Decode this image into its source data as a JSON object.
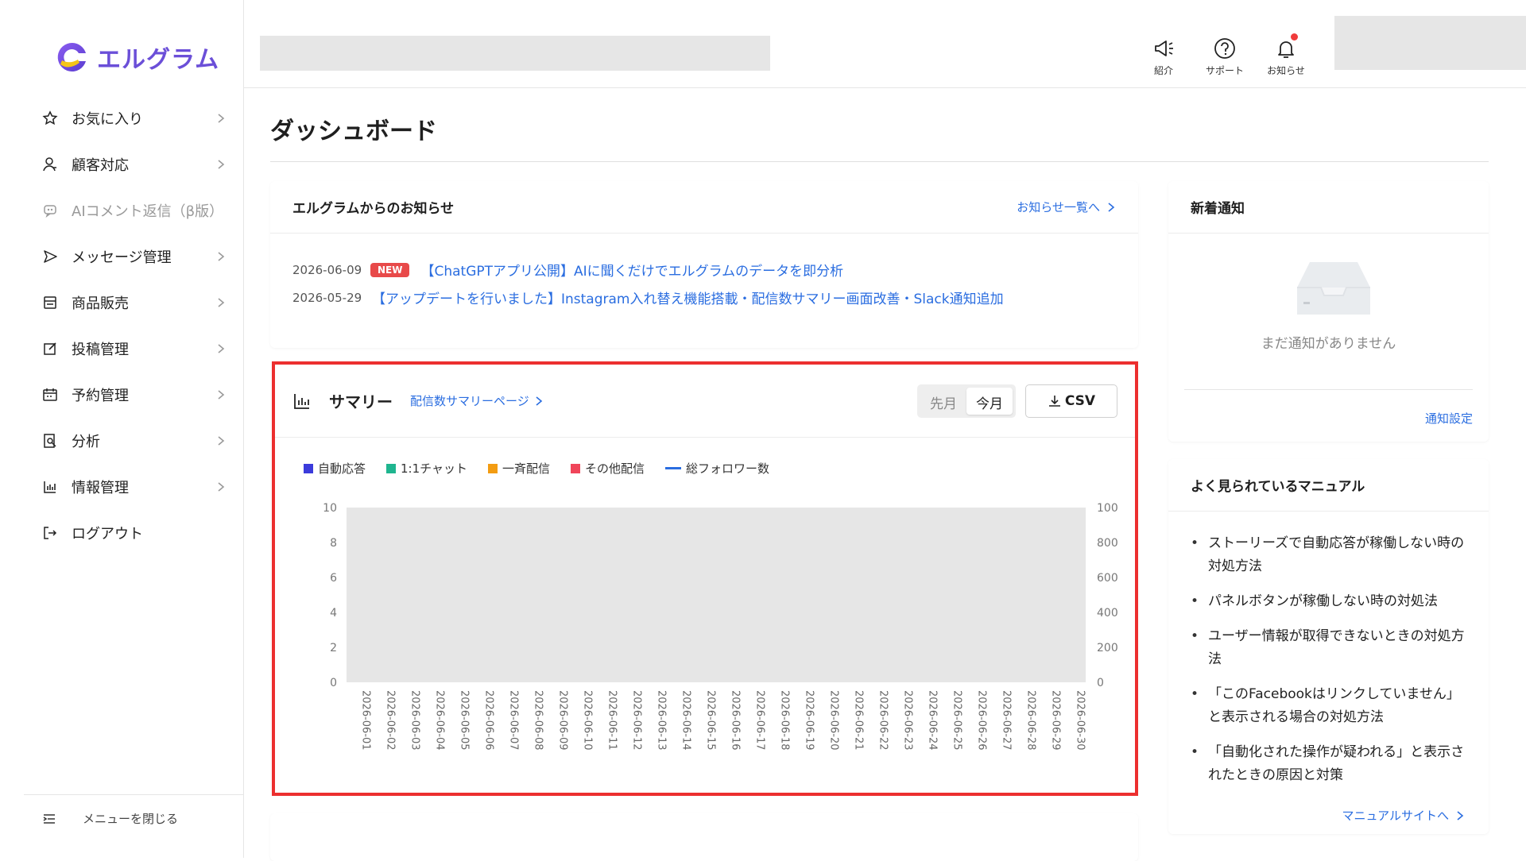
{
  "app": {
    "logo_text": "エルグラム",
    "brand_color": "#6b4fd8"
  },
  "sidebar": {
    "items": [
      {
        "label": "お気に入り",
        "icon": "star-icon",
        "has_chevron": true
      },
      {
        "label": "顧客対応",
        "icon": "user-icon",
        "has_chevron": true
      },
      {
        "label": "AIコメント返信（β版）",
        "icon": "ai-icon",
        "has_chevron": false,
        "disabled": true
      },
      {
        "label": "メッセージ管理",
        "icon": "send-icon",
        "has_chevron": true
      },
      {
        "label": "商品販売",
        "icon": "store-icon",
        "has_chevron": true
      },
      {
        "label": "投稿管理",
        "icon": "edit-icon",
        "has_chevron": true
      },
      {
        "label": "予約管理",
        "icon": "calendar-icon",
        "has_chevron": true
      },
      {
        "label": "分析",
        "icon": "analysis-icon",
        "has_chevron": true
      },
      {
        "label": "情報管理",
        "icon": "bar-chart-icon",
        "has_chevron": true
      },
      {
        "label": "ログアウト",
        "icon": "logout-icon",
        "has_chevron": false
      }
    ],
    "collapse_label": "メニューを閉じる"
  },
  "topbar": {
    "intro_label": "紹介",
    "support_label": "サポート",
    "notice_label": "お知らせ"
  },
  "page": {
    "title": "ダッシュボード"
  },
  "notice": {
    "title": "エルグラムからのお知らせ",
    "more_label": "お知らせ一覧へ",
    "items": [
      {
        "date": "2026-06-09",
        "badge": "NEW",
        "text": "【ChatGPTアプリ公開】AIに聞くだけでエルグラムのデータを即分析"
      },
      {
        "date": "2026-05-29",
        "badge": "",
        "text": "【アップデートを行いました】Instagram入れ替え機能搭載・配信数サマリー画面改善・Slack通知追加"
      }
    ]
  },
  "summary": {
    "title": "サマリー",
    "link_label": "配信数サマリーページ",
    "prev_month": "先月",
    "this_month": "今月",
    "csv_label": "CSV",
    "legend": [
      {
        "name": "自動応答",
        "color": "#3b3bdb",
        "kind": "square"
      },
      {
        "name": "1:1チャット",
        "color": "#1fb58f",
        "kind": "square"
      },
      {
        "name": "一斉配信",
        "color": "#f39c12",
        "kind": "square"
      },
      {
        "name": "その他配信",
        "color": "#f0455a",
        "kind": "square"
      },
      {
        "name": "総フォロワー数",
        "color": "#2a6de0",
        "kind": "line"
      }
    ]
  },
  "chart_data": {
    "type": "bar",
    "categories": [
      "2026-06-01",
      "2026-06-02",
      "2026-06-03",
      "2026-06-04",
      "2026-06-05",
      "2026-06-06",
      "2026-06-07",
      "2026-06-08",
      "2026-06-09",
      "2026-06-10",
      "2026-06-11",
      "2026-06-12",
      "2026-06-13",
      "2026-06-14",
      "2026-06-15",
      "2026-06-16",
      "2026-06-17",
      "2026-06-18",
      "2026-06-19",
      "2026-06-20",
      "2026-06-21",
      "2026-06-22",
      "2026-06-23",
      "2026-06-24",
      "2026-06-25",
      "2026-06-26",
      "2026-06-27",
      "2026-06-28",
      "2026-06-29",
      "2026-06-30"
    ],
    "left_ticks": [
      10,
      8,
      6,
      4,
      2,
      0
    ],
    "right_ticks": [
      1000,
      800,
      600,
      400,
      200,
      0
    ],
    "ylim": [
      0,
      10
    ],
    "y2lim": [
      0,
      1000
    ],
    "series": []
  },
  "new_notifications": {
    "title": "新着通知",
    "empty_text": "まだ通知がありません",
    "settings_label": "通知設定"
  },
  "manuals": {
    "title": "よく見られているマニュアル",
    "items": [
      "ストーリーズで自動応答が稼働しない時の対処方法",
      "パネルボタンが稼働しない時の対処法",
      "ユーザー情報が取得できないときの対処方法",
      "「このFacebookはリンクしていません」と表示される場合の対処方法",
      "「自動化された操作が疑われる」と表示されたときの原因と対策"
    ],
    "site_label": "マニュアルサイトへ"
  }
}
